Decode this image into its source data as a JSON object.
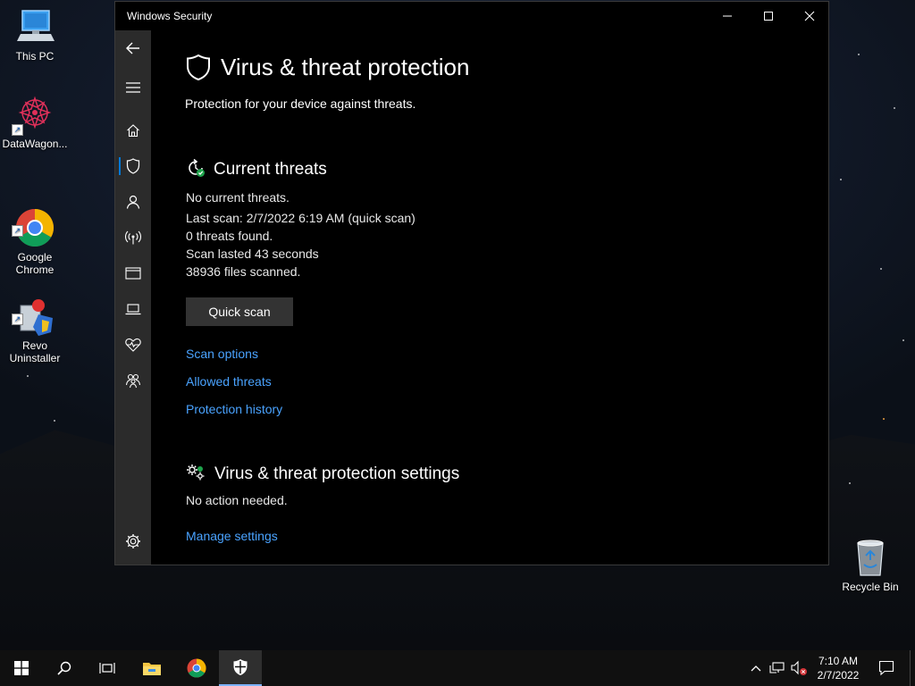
{
  "desktop": {
    "icons": [
      {
        "label": "This PC"
      },
      {
        "label": "DataWagon..."
      },
      {
        "label": "Google\nChrome"
      },
      {
        "label": "Revo\nUninstaller"
      },
      {
        "label": "Recycle Bin"
      }
    ]
  },
  "window": {
    "title": "Windows Security",
    "controls": {
      "minimize": "minimize-icon",
      "maximize": "maximize-icon",
      "close": "close-icon"
    }
  },
  "sidebar": {
    "items": [
      {
        "name": "back",
        "icon": "back-arrow-icon"
      },
      {
        "name": "menu",
        "icon": "hamburger-icon"
      },
      {
        "name": "home",
        "icon": "home-icon"
      },
      {
        "name": "virus-protection",
        "icon": "shield-icon",
        "active": true
      },
      {
        "name": "account",
        "icon": "person-icon"
      },
      {
        "name": "firewall",
        "icon": "wireless-icon"
      },
      {
        "name": "app-browser",
        "icon": "window-icon"
      },
      {
        "name": "device-security",
        "icon": "laptop-icon"
      },
      {
        "name": "device-performance",
        "icon": "heart-icon"
      },
      {
        "name": "family",
        "icon": "family-icon"
      },
      {
        "name": "settings",
        "icon": "gear-icon"
      }
    ]
  },
  "page": {
    "title": "Virus & threat protection",
    "subtitle": "Protection for your device against threats."
  },
  "current_threats": {
    "title": "Current threats",
    "status": "No current threats.",
    "last_scan": "Last scan: 2/7/2022 6:19 AM (quick scan)",
    "threats_found": "0 threats found.",
    "duration": "Scan lasted 43 seconds",
    "files_scanned": "38936 files scanned.",
    "quick_scan_label": "Quick scan",
    "links": [
      "Scan options",
      "Allowed threats",
      "Protection history"
    ]
  },
  "protection_settings": {
    "title": "Virus & threat protection settings",
    "status": "No action needed.",
    "manage_link": "Manage settings"
  },
  "taskbar": {
    "buttons": [
      "start-icon",
      "search-icon",
      "task-view-icon",
      "file-explorer-icon",
      "chrome-icon",
      "windows-security-icon"
    ],
    "clock": {
      "time": "7:10 AM",
      "date": "2/7/2022"
    }
  },
  "colors": {
    "accent": "#0078d7",
    "link": "#4aa3ff",
    "button_bg": "#333333"
  }
}
